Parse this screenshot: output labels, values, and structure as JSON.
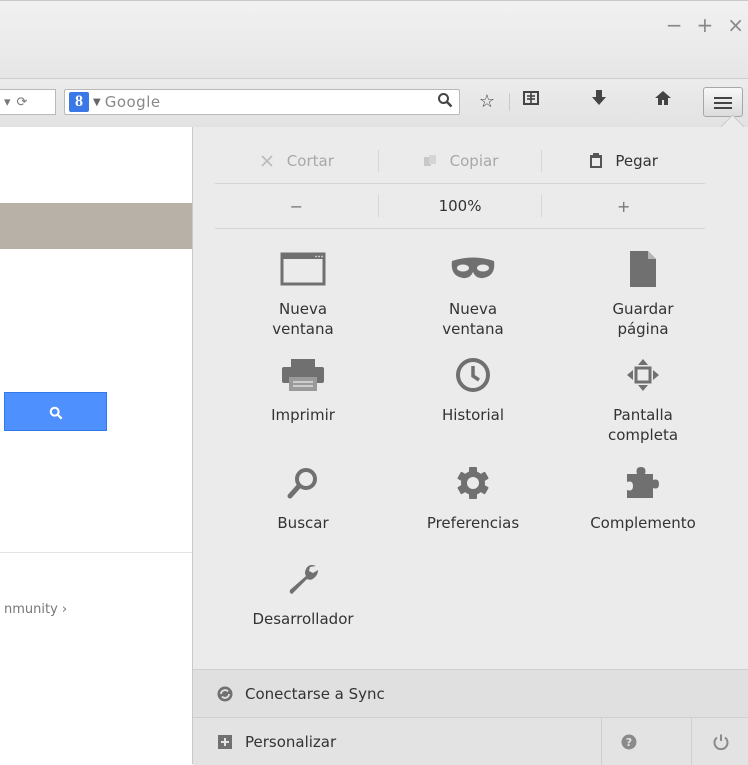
{
  "window": {
    "controls": {
      "minimize": "−",
      "maximize": "+",
      "close": "×"
    }
  },
  "toolbar": {
    "search": {
      "placeholder": "Google",
      "engine_icon": "google-icon"
    },
    "icons": [
      "search-magnifier-icon",
      "bookmark-star-icon",
      "reading-list-icon",
      "download-icon",
      "home-icon",
      "hamburger-menu-icon"
    ]
  },
  "page": {
    "footer_link": "nmunity ›"
  },
  "menu": {
    "edit": {
      "cut": "Cortar",
      "copy": "Copiar",
      "paste": "Pegar"
    },
    "zoom": {
      "out": "−",
      "level": "100%",
      "in": "+"
    },
    "items": [
      {
        "label": "Nueva ventana",
        "icon": "new-window-icon"
      },
      {
        "label": "Nueva ventana",
        "icon": "private-mask-icon"
      },
      {
        "label": "Guardar página",
        "icon": "save-page-icon"
      },
      {
        "label": "Imprimir",
        "icon": "printer-icon"
      },
      {
        "label": "Historial",
        "icon": "clock-icon"
      },
      {
        "label": "Pantalla completa",
        "icon": "fullscreen-icon"
      },
      {
        "label": "Buscar",
        "icon": "magnifier-icon"
      },
      {
        "label": "Preferencias",
        "icon": "gear-icon"
      },
      {
        "label": "Complemento",
        "icon": "puzzle-icon"
      },
      {
        "label": "Desarrollador",
        "icon": "wrench-icon"
      }
    ],
    "sync": "Conectarse a Sync",
    "customize": "Personalizar"
  },
  "colors": {
    "accent_blue": "#4d90fe",
    "panel_bg": "#ebebeb",
    "icon_gray": "#707070"
  }
}
